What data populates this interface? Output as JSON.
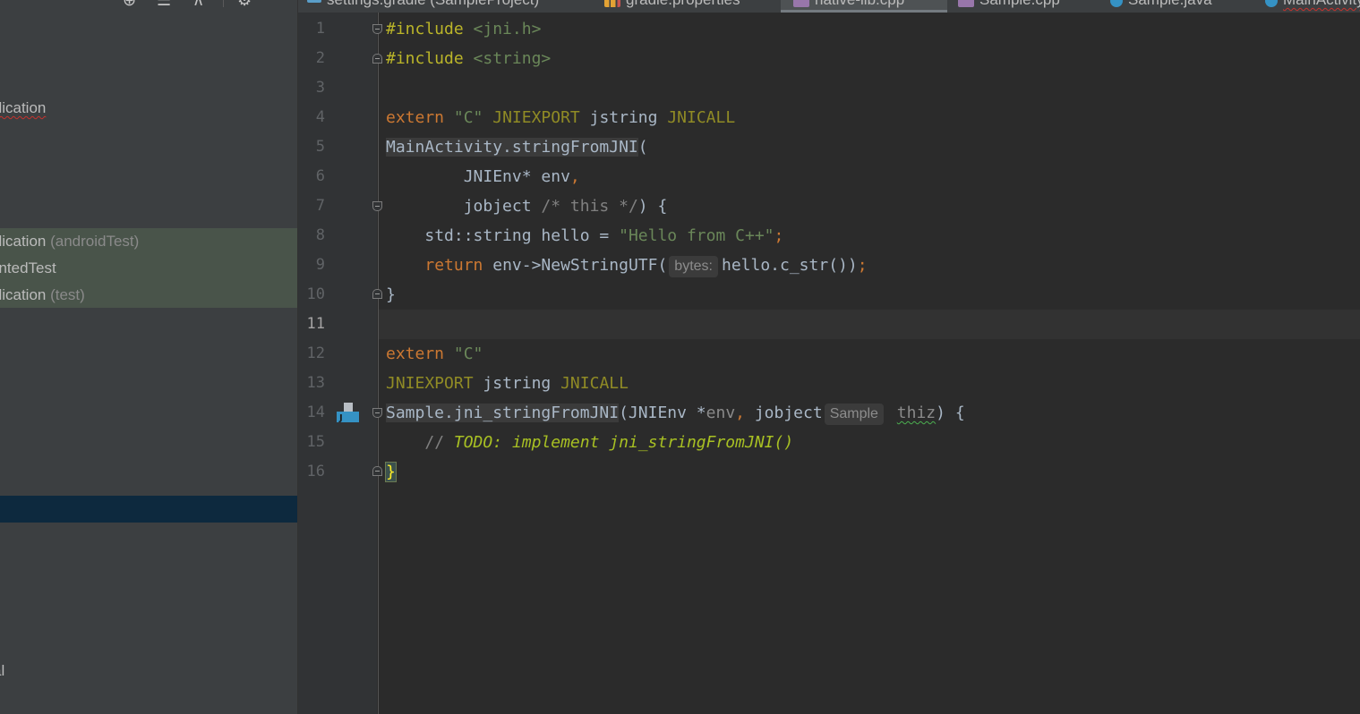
{
  "sidebar": {
    "rows": [
      {
        "label": "plication",
        "suffix": "",
        "style": "normal"
      },
      {
        "label": "plication",
        "suffix": " (androidTest)",
        "style": "test"
      },
      {
        "label": "entedTest",
        "suffix": "",
        "style": "test"
      },
      {
        "label": "plication",
        "suffix": " (test)",
        "style": "test"
      },
      {
        "label": "",
        "suffix": "",
        "style": "selected"
      },
      {
        "label": "al",
        "suffix": "",
        "style": "normal"
      }
    ],
    "toolbar_icons": [
      "globe-icon",
      "collapse-icon",
      "pin-icon",
      "gear-icon"
    ]
  },
  "tabs": [
    {
      "label": "settings.gradle (SampleProject)",
      "icon": "gradle-icon",
      "active": false
    },
    {
      "label": "gradle.properties",
      "icon": "properties-icon",
      "active": false
    },
    {
      "label": "native-lib.cpp",
      "icon": "cpp-file-icon",
      "active": true
    },
    {
      "label": "Sample.cpp",
      "icon": "cpp-file-icon",
      "active": false
    },
    {
      "label": "Sample.java",
      "icon": "java-class-icon",
      "active": false
    },
    {
      "label": "MainActivity",
      "icon": "java-class-icon",
      "active": false
    }
  ],
  "editor": {
    "line_numbers": [
      "1",
      "2",
      "3",
      "4",
      "5",
      "6",
      "7",
      "8",
      "9",
      "10",
      "11",
      "12",
      "13",
      "14",
      "15",
      "16"
    ],
    "current_line": "11",
    "lines": {
      "l1": {
        "directive": "#include",
        "header": "<jni.h>"
      },
      "l2": {
        "directive": "#include",
        "header": "<string>"
      },
      "l4": {
        "kw": "extern",
        "str": "\"C\"",
        "m1": "JNIEXPORT",
        "type": "jstring",
        "m2": "JNICALL"
      },
      "l5": {
        "fn": "MainActivity.stringFromJNI",
        "rest": "("
      },
      "l6": {
        "text": "JNIEnv* env",
        "comma": ","
      },
      "l7": {
        "type": "jobject",
        "comment": "/* this */",
        "rest": ") {"
      },
      "l8": {
        "text": "std::string hello = ",
        "str": "\"Hello from C++\"",
        "semi": ";"
      },
      "l9": {
        "kw": "return",
        "text": " env->NewStringUTF(",
        "hint": "bytes:",
        "arg": "hello.c_str())",
        "semi": ";"
      },
      "l10": {
        "text": "}"
      },
      "l12": {
        "kw": "extern",
        "str": "\"C\""
      },
      "l13": {
        "m1": "JNIEXPORT",
        "type": "jstring",
        "m2": "JNICALL"
      },
      "l14": {
        "fn": "Sample.jni_stringFromJNI",
        "p1": "(JNIEnv *",
        "env": "env",
        "comma": ",",
        "p2": " jobject",
        "hint": "Sample",
        "thiz": "thiz",
        "rest": ") {"
      },
      "l15": {
        "slashes": "// ",
        "todo": "TODO: implement jni_stringFromJNI()"
      },
      "l16": {
        "text": "}"
      }
    }
  }
}
